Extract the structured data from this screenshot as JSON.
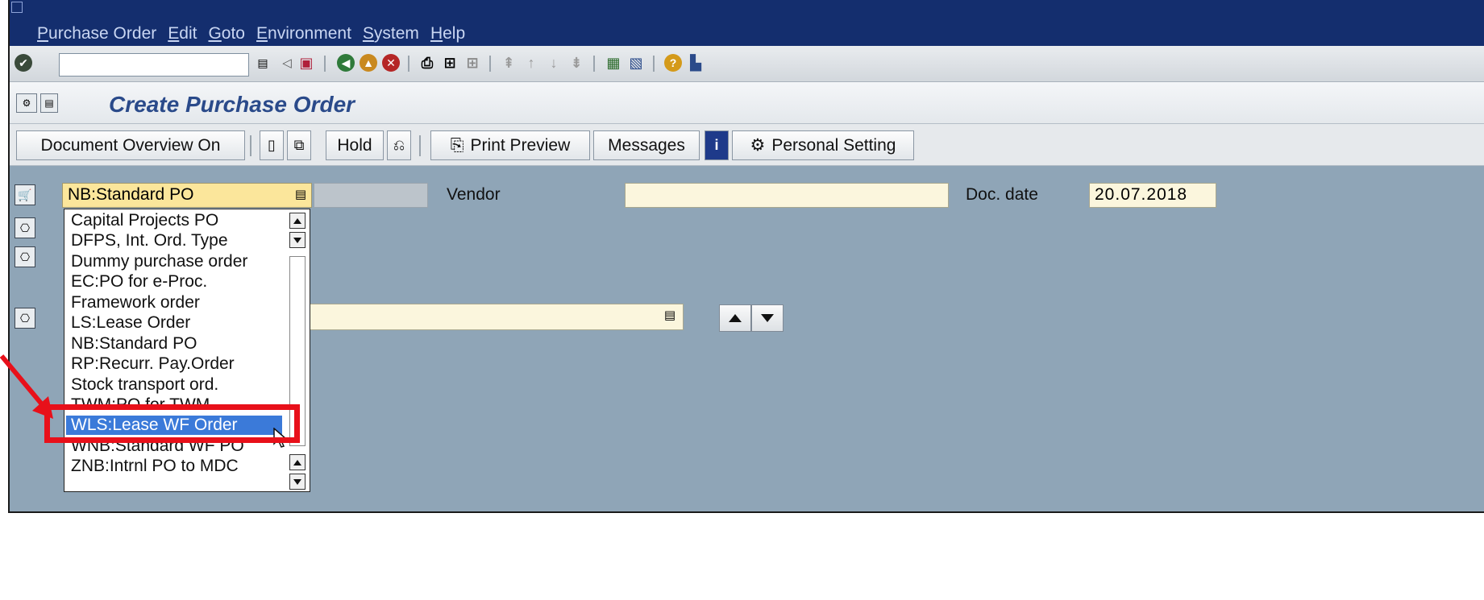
{
  "menu": [
    "Purchase Order",
    "Edit",
    "Goto",
    "Environment",
    "System",
    "Help"
  ],
  "toolbar": {
    "command_value": ""
  },
  "title": "Create Purchase Order",
  "app_toolbar": {
    "doc_overview": "Document Overview On",
    "hold": "Hold",
    "print_preview": "Print Preview",
    "messages": "Messages",
    "personal_setting": "Personal Setting"
  },
  "header": {
    "order_type": "NB:Standard PO",
    "vendor_label": "Vendor",
    "vendor_value": "",
    "doc_date_label": "Doc. date",
    "doc_date_value": "20.07.2018"
  },
  "dropdown": {
    "items": [
      "Capital Projects PO",
      "DFPS, Int. Ord. Type",
      "Dummy purchase order",
      "EC:PO for e-Proc.",
      "Framework order",
      "LS:Lease Order",
      "NB:Standard PO",
      "RP:Recurr. Pay.Order",
      "Stock transport ord.",
      "TWM:PO for TWM",
      "WLS:Lease WF Order",
      "WNB:Standard WF PO",
      "ZNB:Intrnl PO to MDC"
    ],
    "selected": "WLS:Lease WF Order"
  },
  "colors": {
    "highlight": "#e8101a",
    "selection": "#3b7ad9",
    "menubar": "#142e6e"
  }
}
